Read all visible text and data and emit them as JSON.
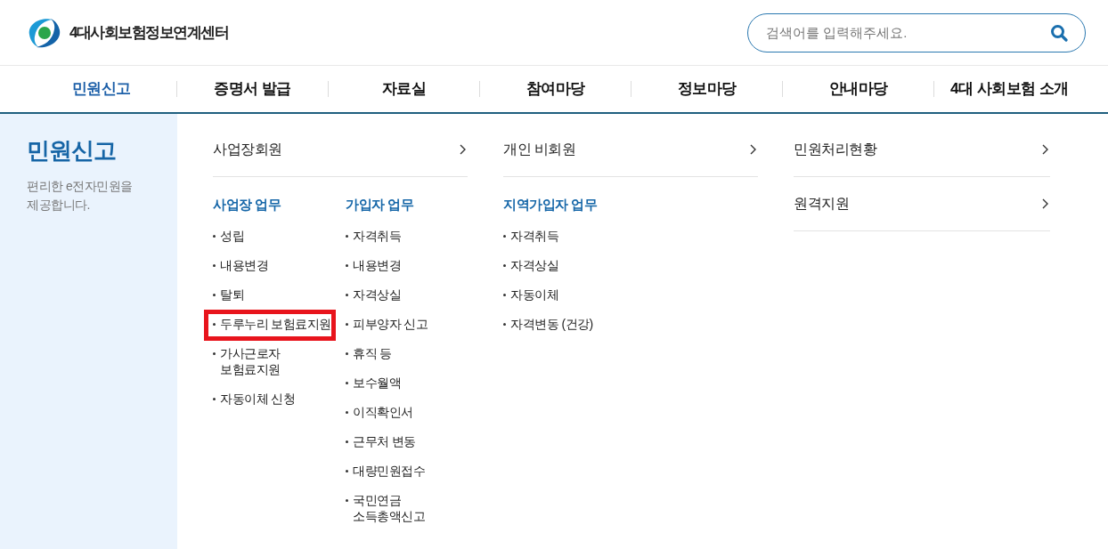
{
  "header": {
    "site_title": "4대사회보험정보연계센터",
    "search": {
      "placeholder": "검색어를 입력해주세요."
    }
  },
  "nav": [
    {
      "label": "민원신고",
      "selected": true
    },
    {
      "label": "증명서 발급",
      "selected": false
    },
    {
      "label": "자료실",
      "selected": false
    },
    {
      "label": "참여마당",
      "selected": false
    },
    {
      "label": "정보마당",
      "selected": false
    },
    {
      "label": "안내마당",
      "selected": false
    },
    {
      "label": "4대 사회보험 소개",
      "selected": false
    }
  ],
  "side_panel": {
    "title": "민원신고",
    "description": "편리한 e전자민원을\n제공합니다."
  },
  "menu_columns": [
    {
      "links": [
        {
          "label": "사업장회원"
        }
      ],
      "groups": [
        {
          "heading": "사업장 업무",
          "items": [
            {
              "label": "성립",
              "highlighted": false
            },
            {
              "label": "내용변경",
              "highlighted": false
            },
            {
              "label": "탈퇴",
              "highlighted": false
            },
            {
              "label": "두루누리 보험료지원",
              "highlighted": true
            },
            {
              "label": "가사근로자\n보험료지원",
              "highlighted": false
            },
            {
              "label": "자동이체 신청",
              "highlighted": false
            }
          ]
        },
        {
          "heading": "가입자 업무",
          "items": [
            {
              "label": "자격취득",
              "highlighted": false
            },
            {
              "label": "내용변경",
              "highlighted": false
            },
            {
              "label": "자격상실",
              "highlighted": false
            },
            {
              "label": "피부양자 신고",
              "highlighted": false
            },
            {
              "label": "휴직 등",
              "highlighted": false
            },
            {
              "label": "보수월액",
              "highlighted": false
            },
            {
              "label": "이직확인서",
              "highlighted": false
            },
            {
              "label": "근무처 변동",
              "highlighted": false
            },
            {
              "label": "대량민원접수",
              "highlighted": false
            },
            {
              "label": "국민연금\n소득총액신고",
              "highlighted": false
            }
          ]
        }
      ]
    },
    {
      "links": [
        {
          "label": "개인 비회원"
        }
      ],
      "groups": [
        {
          "heading": "지역가입자 업무",
          "items": [
            {
              "label": "자격취득",
              "highlighted": false
            },
            {
              "label": "자격상실",
              "highlighted": false
            },
            {
              "label": "자동이체",
              "highlighted": false
            },
            {
              "label": "자격변동 (건강)",
              "highlighted": false
            }
          ]
        }
      ]
    },
    {
      "links": [
        {
          "label": "민원처리현황"
        },
        {
          "label": "원격지원"
        }
      ]
    }
  ]
}
